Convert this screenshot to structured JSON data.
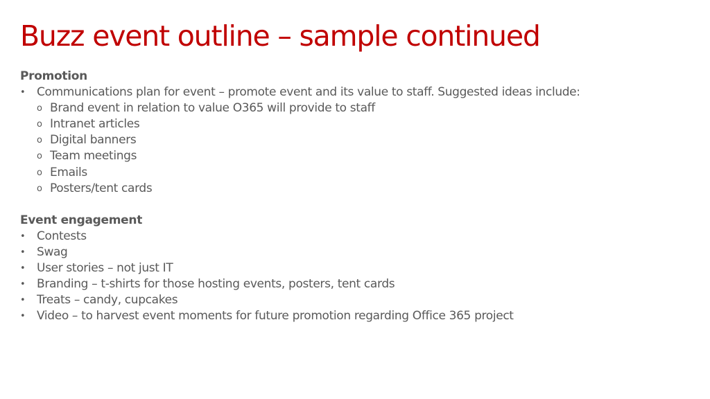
{
  "slide": {
    "title": "Buzz event outline – sample continued",
    "title_color": "#C00000",
    "text_color": "#595959"
  },
  "promotion": {
    "heading": "Promotion",
    "items": [
      {
        "bullet": "•",
        "text": "Communications plan for event – promote event and its value to staff. Suggested ideas include:",
        "subitems": [
          {
            "bullet": "o",
            "text": "Brand event in relation to value O365 will provide to staff"
          },
          {
            "bullet": "o",
            "text": "Intranet articles"
          },
          {
            "bullet": "o",
            "text": "Digital banners"
          },
          {
            "bullet": "o",
            "text": "Team meetings"
          },
          {
            "bullet": "o",
            "text": "Emails"
          },
          {
            "bullet": "o",
            "text": "Posters/tent cards"
          }
        ]
      }
    ]
  },
  "engagement": {
    "heading": "Event engagement",
    "items": [
      {
        "bullet": "•",
        "text": "Contests"
      },
      {
        "bullet": "•",
        "text": "Swag"
      },
      {
        "bullet": "•",
        "text": "User stories – not just IT"
      },
      {
        "bullet": "•",
        "text": "Branding – t-shirts for those hosting events, posters, tent cards"
      },
      {
        "bullet": "•",
        "text": "Treats – candy, cupcakes"
      },
      {
        "bullet": "•",
        "text": "Video – to harvest event moments for future promotion regarding Office 365 project"
      }
    ]
  }
}
